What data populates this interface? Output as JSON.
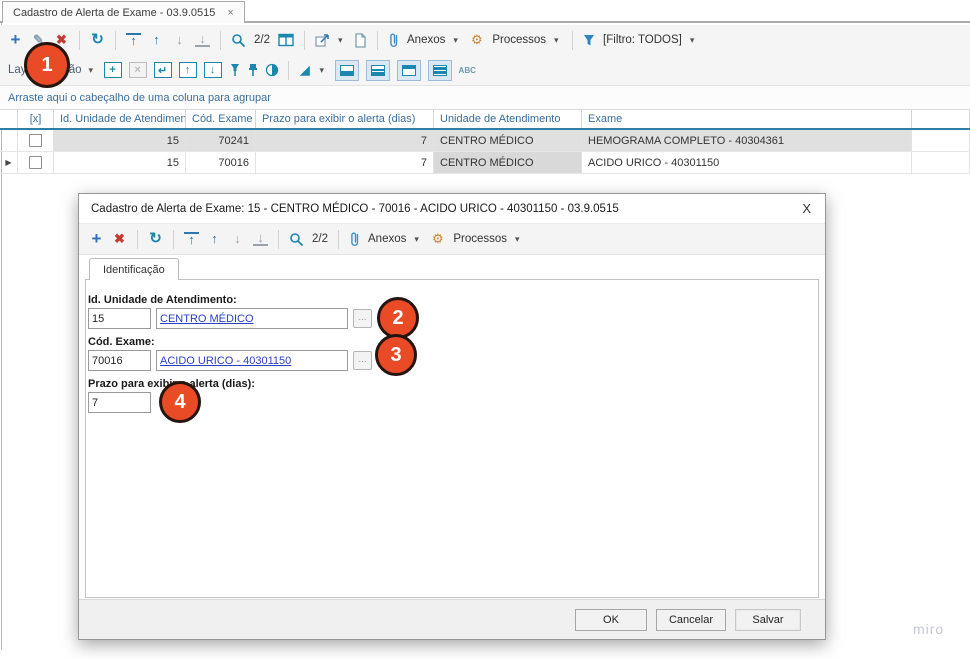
{
  "window": {
    "tab_title": "Cadastro de Alerta de Exame - 03.9.0515",
    "close_glyph": "×"
  },
  "icons": {
    "add": "+",
    "edit": "✎",
    "delete": "✖",
    "refresh": "↻",
    "up": "↑",
    "down": "↓",
    "caret": "▾",
    "gear": "⚙",
    "row_indicator": "▶",
    "chart": "◢",
    "box_add": "+",
    "box_delete": "×",
    "box_return": "↵",
    "box_up": "↑",
    "box_down": "↓"
  },
  "toolbar_main": {
    "record_counter": "2/2",
    "anexos": "Anexos",
    "processos": "Processos",
    "filtro": "[Filtro: TODOS]"
  },
  "toolbar_layout": {
    "label": "Layout padrão",
    "abc": "ABC"
  },
  "group_bar": "Arraste aqui o cabeçalho de uma coluna para agrupar",
  "grid": {
    "columns": [
      "[x]",
      "Id. Unidade de Atendimento",
      "Cód. Exame",
      "Prazo para exibir o alerta (dias)",
      "Unidade de Atendimento",
      "Exame"
    ],
    "rows": [
      {
        "id_unidade": "15",
        "cod_exame": "70241",
        "prazo": "7",
        "unidade": "CENTRO MÉDICO",
        "exame": "HEMOGRAMA COMPLETO - 40304361"
      },
      {
        "id_unidade": "15",
        "cod_exame": "70016",
        "prazo": "7",
        "unidade": "CENTRO MÉDICO",
        "exame": "ACIDO URICO - 40301150"
      }
    ]
  },
  "dialog": {
    "title": "Cadastro de Alerta de Exame: 15 - CENTRO MÉDICO - 70016 - ACIDO URICO - 40301150 - 03.9.0515",
    "close_glyph": "X",
    "toolbar": {
      "record_counter": "2/2",
      "anexos": "Anexos",
      "processos": "Processos"
    },
    "tab": "Identificação",
    "fields": {
      "id_unidade_label": "Id. Unidade de Atendimento:",
      "id_unidade_value": "15",
      "id_unidade_desc": "CENTRO MÉDICO",
      "cod_exame_label": "Cód. Exame:",
      "cod_exame_value": "70016",
      "cod_exame_desc": "ACIDO URICO - 40301150",
      "prazo_label": "Prazo para exibir o alerta (dias):",
      "prazo_value": "7",
      "lookup_button": "..."
    },
    "buttons": {
      "ok": "OK",
      "cancel": "Cancelar",
      "save": "Salvar"
    }
  },
  "annotations": [
    "1",
    "2",
    "3",
    "4"
  ],
  "watermark": "miro",
  "colors": {
    "accent_teal": "#1b86ae",
    "accent_blue": "#2e77ad",
    "danger_red": "#c23b34",
    "link_blue": "#2b3fc4",
    "header_blue": "#3b6e9c",
    "selection_gray": "#e0e0e0",
    "annotation_red": "#e84b25",
    "toolbar_bg": "#f5f5f6"
  }
}
